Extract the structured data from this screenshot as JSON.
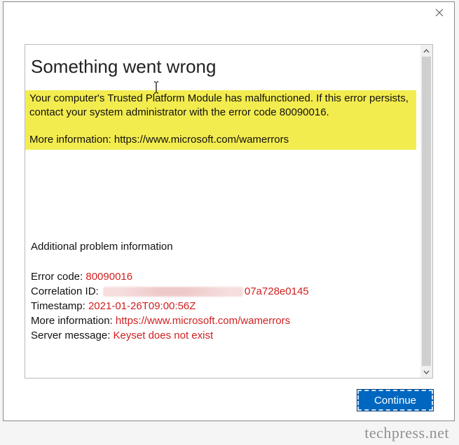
{
  "dialog": {
    "title": "Something went wrong",
    "highlight": {
      "line1": "Your computer's Trusted Platform Module has malfunctioned. If this error persists, contact your system administrator with the error code 80090016.",
      "line3": "More information: https://www.microsoft.com/wamerrors"
    },
    "additional_heading": "Additional problem information",
    "details": {
      "error_code_label": "Error code: ",
      "error_code_value": "80090016",
      "correlation_label": "Correlation ID: ",
      "correlation_suffix": "07a728e0145",
      "timestamp_label": "Timestamp: ",
      "timestamp_value": "2021-01-26T09:00:56Z",
      "more_info_label": "More information: ",
      "more_info_value": "https://www.microsoft.com/wamerrors",
      "server_msg_label": "Server message: ",
      "server_msg_value": "Keyset does not exist"
    },
    "continue_label": "Continue"
  },
  "watermark": "techpress.net"
}
